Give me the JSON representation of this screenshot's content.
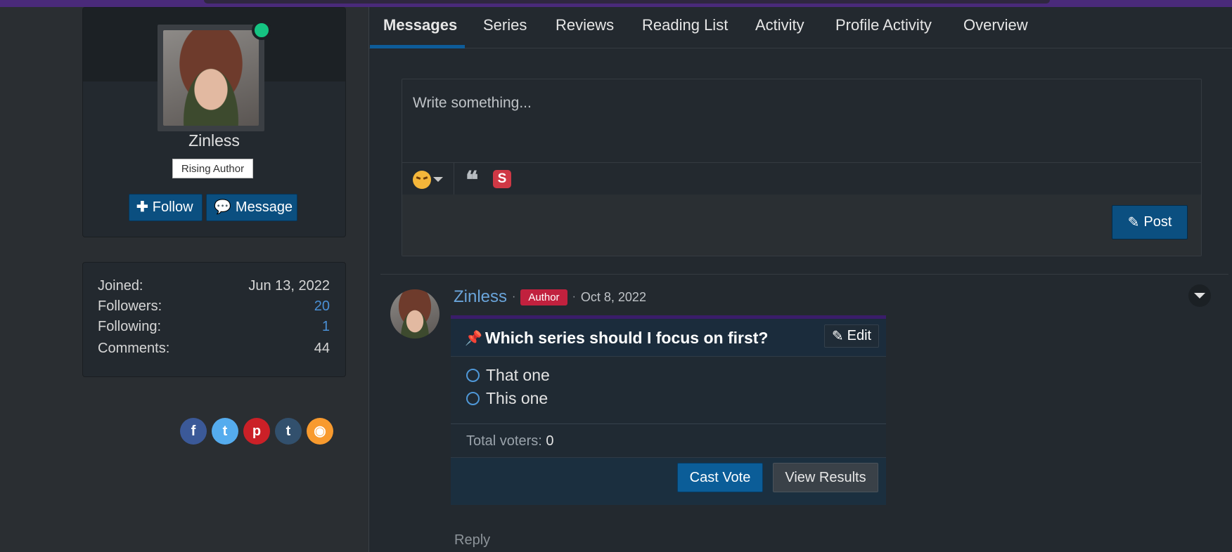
{
  "profile": {
    "name": "Zinless",
    "rank": "Rising Author",
    "follow_label": "Follow",
    "message_label": "Message",
    "status_color": "#15c482"
  },
  "stats": [
    {
      "label": "Joined:",
      "value": "Jun 13, 2022"
    },
    {
      "label": "Followers:",
      "value": "20"
    },
    {
      "label": "Following:",
      "value": "1"
    },
    {
      "label": "Comments:",
      "value": "44"
    }
  ],
  "social": [
    {
      "name": "facebook-icon",
      "glyph": "f",
      "color": "#3b5998"
    },
    {
      "name": "twitter-icon",
      "glyph": "t",
      "color": "#55acee"
    },
    {
      "name": "pinterest-icon",
      "glyph": "p",
      "color": "#cb2027"
    },
    {
      "name": "tumblr-icon",
      "glyph": "t",
      "color": "#32506d"
    },
    {
      "name": "rss-icon",
      "glyph": "◉",
      "color": "#f89a2e"
    }
  ],
  "tabs": [
    "Messages",
    "Series",
    "Reviews",
    "Reading List",
    "Activity",
    "Profile Activity",
    "Overview"
  ],
  "composer": {
    "placeholder": "Write something...",
    "quote_glyph": "❝",
    "spoiler_glyph": "S",
    "post_label": "Post"
  },
  "message": {
    "author": "Zinless",
    "badge": "Author",
    "date": "Oct 8, 2022",
    "reply_label": "Reply"
  },
  "poll": {
    "question": "Which series should I focus on first?",
    "edit_label": "Edit",
    "options": [
      "That one",
      "This one"
    ],
    "voters_label": "Total voters:",
    "voters_count": "0",
    "cast_label": "Cast Vote",
    "results_label": "View Results"
  }
}
